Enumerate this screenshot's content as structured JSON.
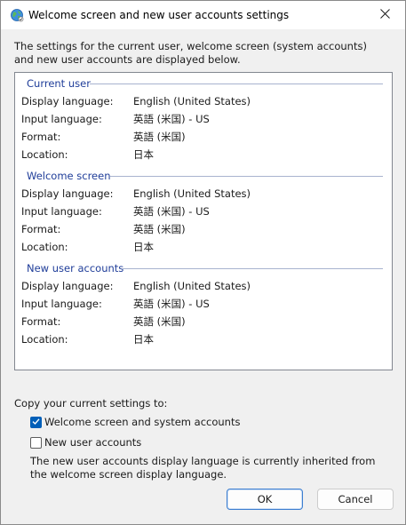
{
  "window": {
    "title": "Welcome screen and new user accounts settings",
    "close_label": "×"
  },
  "intro_text": "The settings for the current user, welcome screen (system accounts) and new user accounts are displayed below.",
  "sections": [
    {
      "heading": "Current user",
      "rows": [
        {
          "label": "Display language:",
          "value": "English (United States)"
        },
        {
          "label": "Input language:",
          "value": "英語 (米国) - US"
        },
        {
          "label": "Format:",
          "value": "英語 (米国)"
        },
        {
          "label": "Location:",
          "value": "日本"
        }
      ]
    },
    {
      "heading": "Welcome screen",
      "rows": [
        {
          "label": "Display language:",
          "value": "English (United States)"
        },
        {
          "label": "Input language:",
          "value": "英語 (米国) - US"
        },
        {
          "label": "Format:",
          "value": "英語 (米国)"
        },
        {
          "label": "Location:",
          "value": "日本"
        }
      ]
    },
    {
      "heading": "New user accounts",
      "rows": [
        {
          "label": "Display language:",
          "value": "English (United States)"
        },
        {
          "label": "Input language:",
          "value": "英語 (米国) - US"
        },
        {
          "label": "Format:",
          "value": "英語 (米国)"
        },
        {
          "label": "Location:",
          "value": "日本"
        }
      ]
    }
  ],
  "copy": {
    "label": "Copy your current settings to:",
    "options": [
      {
        "label": "Welcome screen and system accounts",
        "checked": true
      },
      {
        "label": "New user accounts",
        "checked": false
      }
    ],
    "note": "The new user accounts display language is currently inherited from the welcome screen display language."
  },
  "buttons": {
    "ok": "OK",
    "cancel": "Cancel"
  },
  "colors": {
    "accent": "#005fb8",
    "section_heading": "#1f3d99"
  },
  "icons": {
    "title": "globe-icon",
    "close": "close-icon",
    "check": "checkmark-icon"
  }
}
